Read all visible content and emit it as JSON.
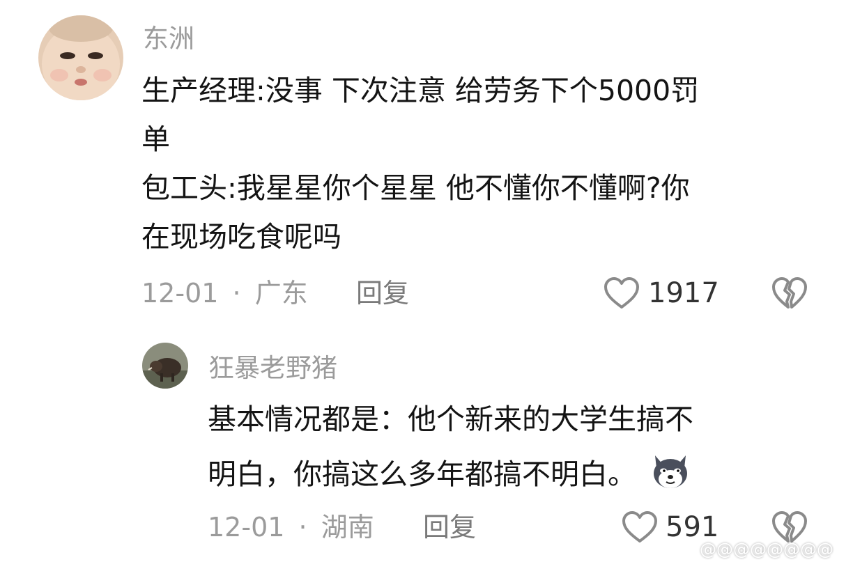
{
  "comments": [
    {
      "username": "东洲",
      "lines": [
        "生产经理:没事 下次注意 给劳务下个5000罚",
        "单",
        "包工头:我星星你个星星 他不懂你不懂啊?你",
        "在现场吃食呢吗"
      ],
      "date": "12-01",
      "separator": "·",
      "location": "广东",
      "reply_label": "回复",
      "like_count": "1917",
      "avatar_icon": "baby-face-avatar",
      "like_icon": "heart-outline-icon",
      "dislike_icon": "broken-heart-icon"
    },
    {
      "username": "狂暴老野猪",
      "lines": [
        "基本情况都是：他个新来的大学生搞不",
        "明白，你搞这么多年都搞不明白。"
      ],
      "date": "12-01",
      "separator": "·",
      "location": "湖南",
      "reply_label": "回复",
      "like_count": "591",
      "avatar_icon": "wild-boar-avatar",
      "emoji_icon": "doge-emoji-icon",
      "like_icon": "heart-outline-icon",
      "dislike_icon": "broken-heart-icon"
    }
  ],
  "watermark": "@@@@@@@@",
  "colors": {
    "text": "#141414",
    "meta": "#9b9b9b",
    "count": "#333333"
  }
}
